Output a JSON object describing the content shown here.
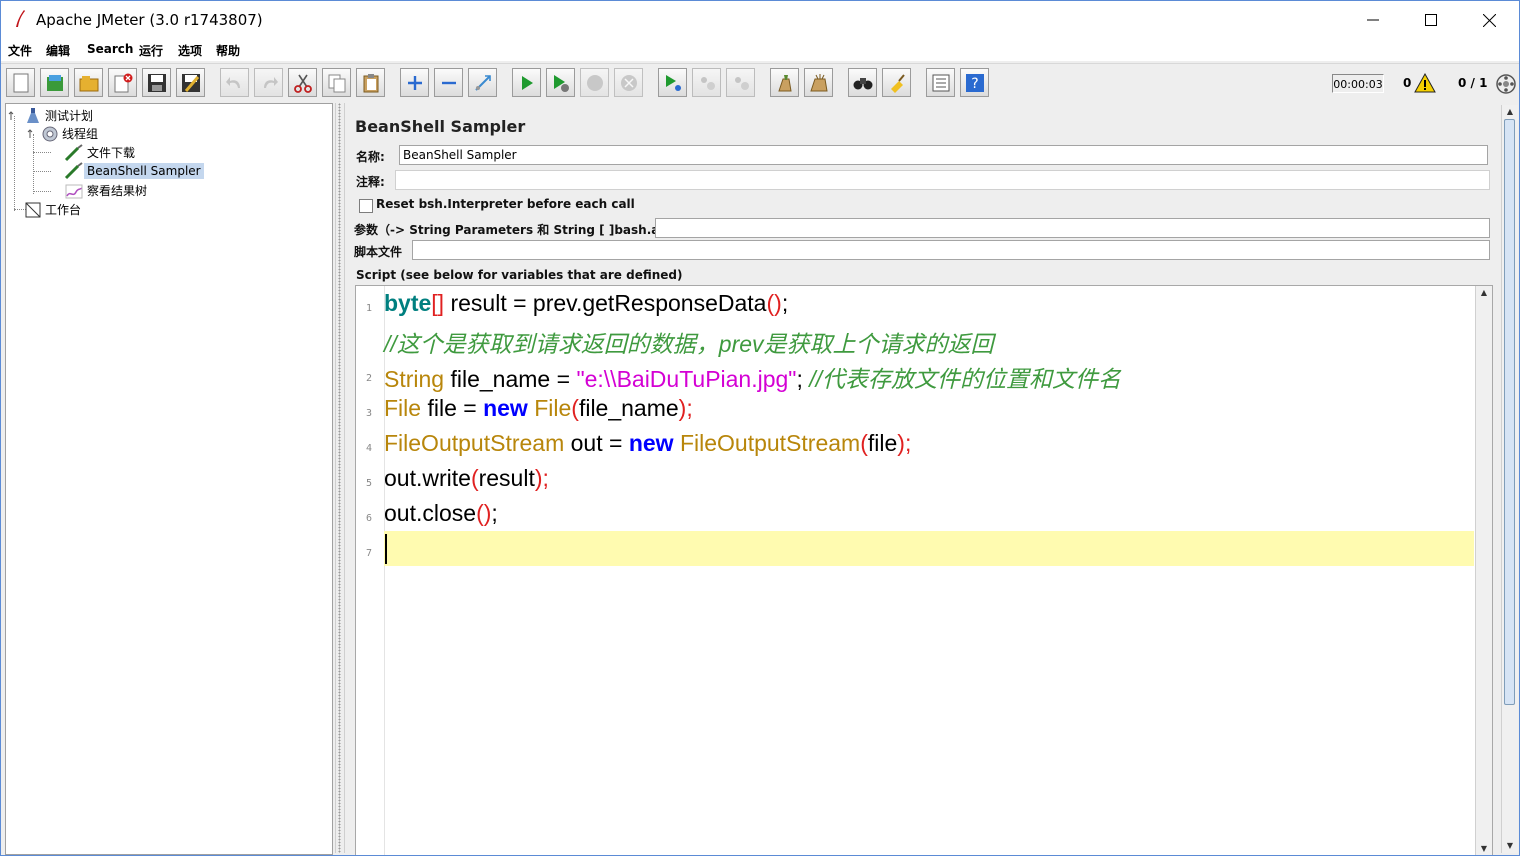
{
  "window": {
    "title": "Apache JMeter (3.0 r1743807)",
    "controls": {
      "minimize": "—",
      "maximize": "☐",
      "close": "✕"
    }
  },
  "menubar": {
    "items": [
      "文件",
      "编辑",
      "Search",
      "运行",
      "选项",
      "帮助"
    ]
  },
  "toolbar": {
    "icons": [
      "new-icon",
      "templates-icon",
      "open-icon",
      "close-icon",
      "save-icon",
      "save-as-icon",
      "undo-icon",
      "redo-icon",
      "cut-icon",
      "copy-icon",
      "paste-icon",
      "expand-icon",
      "collapse-icon",
      "toggle-icon",
      "start-icon",
      "start-no-pause-icon",
      "stop-icon",
      "shutdown-icon",
      "remote-start-icon",
      "remote-stop-icon",
      "remote-shutdown-icon",
      "clear-icon",
      "clear-all-icon",
      "search-icon",
      "reset-search-icon",
      "function-helper-icon",
      "help-icon"
    ],
    "timer": "00:00:03",
    "warning_count": "0",
    "threads": "0 / 1"
  },
  "tree": {
    "nodes": [
      {
        "label": "测试计划",
        "icon": "test-plan-icon"
      },
      {
        "label": "线程组",
        "icon": "thread-group-icon"
      },
      {
        "label": "文件下载",
        "icon": "sampler-icon"
      },
      {
        "label": "BeanShell Sampler",
        "icon": "sampler-icon",
        "selected": true
      },
      {
        "label": "察看结果树",
        "icon": "listener-icon"
      },
      {
        "label": "工作台",
        "icon": "workbench-icon"
      }
    ]
  },
  "panel": {
    "title": "BeanShell Sampler",
    "name_label": "名称:",
    "name_value": "BeanShell Sampler",
    "comment_label": "注释:",
    "comment_value": "",
    "reset_label": "Reset bsh.Interpreter before each call",
    "reset_checked": false,
    "params_label": "参数（-> String Parameters 和 String [ ]bash.args）",
    "params_value": "",
    "script_file_label": "脚本文件",
    "script_file_value": "",
    "script_label": "Script (see below for variables that are defined)"
  },
  "editor": {
    "line_numbers": [
      "1",
      "2",
      "3",
      "4",
      "5",
      "6",
      "7"
    ],
    "lines": [
      {
        "t1": "byte",
        "t2": "[]",
        "t3": " result = prev.getResponseData",
        "t4": "()",
        "t5": ";"
      },
      {
        "comment": "//这个是获取到请求返回的数据，prev是获取上个请求的返回"
      },
      {
        "t1": "String",
        "t2": " file_name = ",
        "t3": "\"e:\\\\BaiDuTuPian.jpg\"",
        "t4": "; ",
        "t5": "//代表存放文件的位置和文件名"
      },
      {
        "t1": "File",
        "t2": " file = ",
        "t3": "new",
        "t4": " File",
        "t5": "(",
        "t6": "file_name",
        "t7": ");"
      },
      {
        "t1": "FileOutputStream",
        "t2": " out = ",
        "t3": "new",
        "t4": " FileOutputStream",
        "t5": "(",
        "t6": "file",
        "t7": ");"
      },
      {
        "t1": "out.write",
        "t2": "(",
        "t3": "result",
        "t4": ");"
      },
      {
        "t1": "out.close",
        "t2": "()",
        "t3": ";"
      }
    ]
  },
  "colors": {
    "keyword": "#007f7f",
    "new_keyword": "#0000ff",
    "type": "#b8860b",
    "string": "#d400d4",
    "comment": "#3f9a3f",
    "paren": "#e02020",
    "current_line": "#fffbb0",
    "selection": "#c4d7ee"
  }
}
